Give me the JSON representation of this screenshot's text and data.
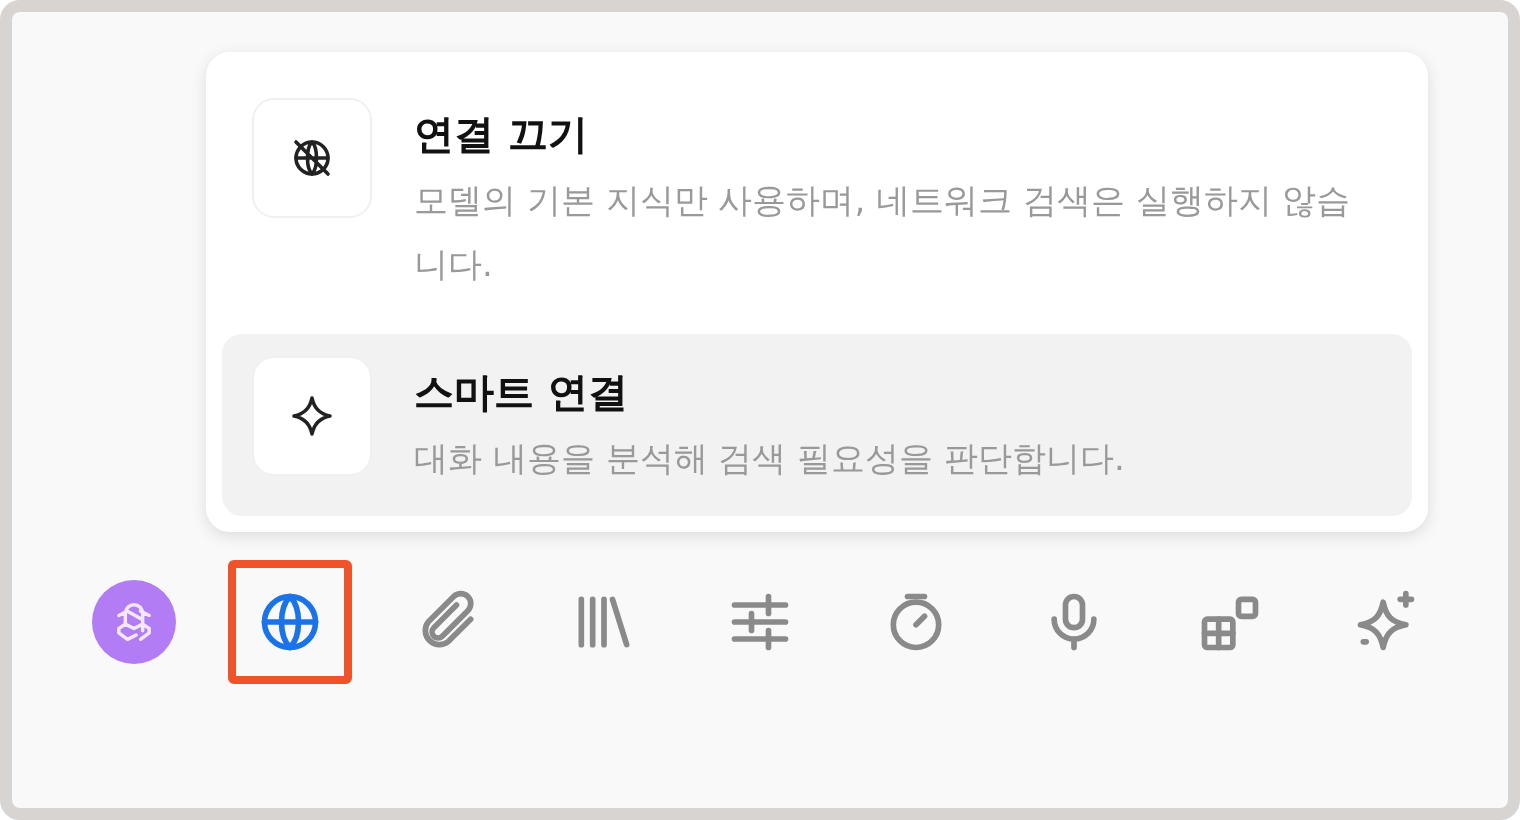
{
  "menu": {
    "options": [
      {
        "kind": "offline",
        "title": "연결 끄기",
        "description": "모델의 기본 지식만 사용하며, 네트워크 검색은 실행하지 않습니다.",
        "selected": false
      },
      {
        "kind": "smart",
        "title": "스마트 연결",
        "description": "대화 내용을 분석해 검색 필요성을 판단합니다.",
        "selected": true
      }
    ]
  },
  "toolbar": [
    {
      "kind": "model",
      "selected": false
    },
    {
      "kind": "globe",
      "selected": true
    },
    {
      "kind": "attach",
      "selected": false
    },
    {
      "kind": "library",
      "selected": false
    },
    {
      "kind": "sliders",
      "selected": false
    },
    {
      "kind": "timer",
      "selected": false
    },
    {
      "kind": "mic",
      "selected": false
    },
    {
      "kind": "apps",
      "selected": false
    },
    {
      "kind": "sparkle",
      "selected": false
    }
  ]
}
